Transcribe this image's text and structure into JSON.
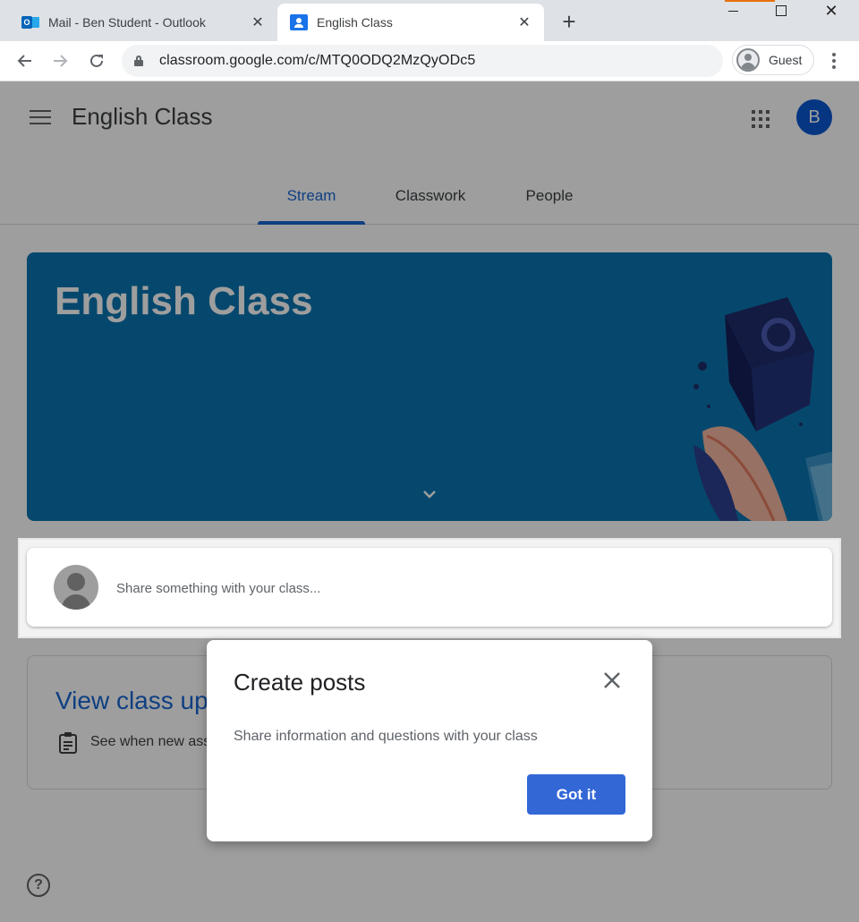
{
  "browser": {
    "tabs": [
      {
        "title": "Mail - Ben Student - Outlook",
        "icon": "outlook-icon",
        "active": false
      },
      {
        "title": "English Class",
        "icon": "google-classroom-icon",
        "active": true
      }
    ],
    "url": "classroom.google.com/c/MTQ0ODQ2MzQyODc5",
    "profile_label": "Guest"
  },
  "header": {
    "class_title": "English Class",
    "avatar_letter": "B",
    "avatar_color": "#0b57d0"
  },
  "class_tabs": [
    {
      "label": "Stream",
      "active": true
    },
    {
      "label": "Classwork",
      "active": false
    },
    {
      "label": "People",
      "active": false
    }
  ],
  "banner": {
    "title": "English Class",
    "color": "#0a74b0"
  },
  "share_box": {
    "placeholder": "Share something with your class..."
  },
  "updates_card": {
    "title": "View class updates",
    "subtitle": "See when new assignments are posted"
  },
  "dialog": {
    "title": "Create posts",
    "body": "Share information and questions with your class",
    "button_label": "Got it",
    "button_color": "#3367d6"
  },
  "accent_color": "#1967d2"
}
